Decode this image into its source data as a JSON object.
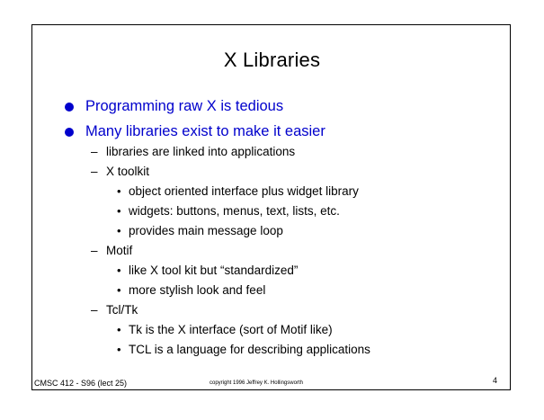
{
  "slide": {
    "title": "X Libraries",
    "bullets": [
      "Programming raw X is tedious",
      "Many libraries exist to make it easier"
    ],
    "sub": {
      "libs_linked": "libraries are linked into applications",
      "xtoolkit": "X toolkit",
      "xtoolkit_items": [
        "object oriented interface plus widget library",
        "widgets: buttons, menus, text, lists, etc.",
        "provides main message loop"
      ],
      "motif": "Motif",
      "motif_items": [
        "like X tool kit but “standardized”",
        "more stylish look and feel"
      ],
      "tcltk": "Tcl/Tk",
      "tcltk_items": [
        "Tk is the X interface (sort of Motif like)",
        "TCL is a language for describing applications"
      ]
    },
    "footer": {
      "course": "CMSC 412 - S96  (lect 25)",
      "copyright": "copyright 1996 Jeffrey K. Hollingsworth",
      "page": "4"
    },
    "colors": {
      "bullet": "#0000cc",
      "text": "#000000"
    }
  }
}
